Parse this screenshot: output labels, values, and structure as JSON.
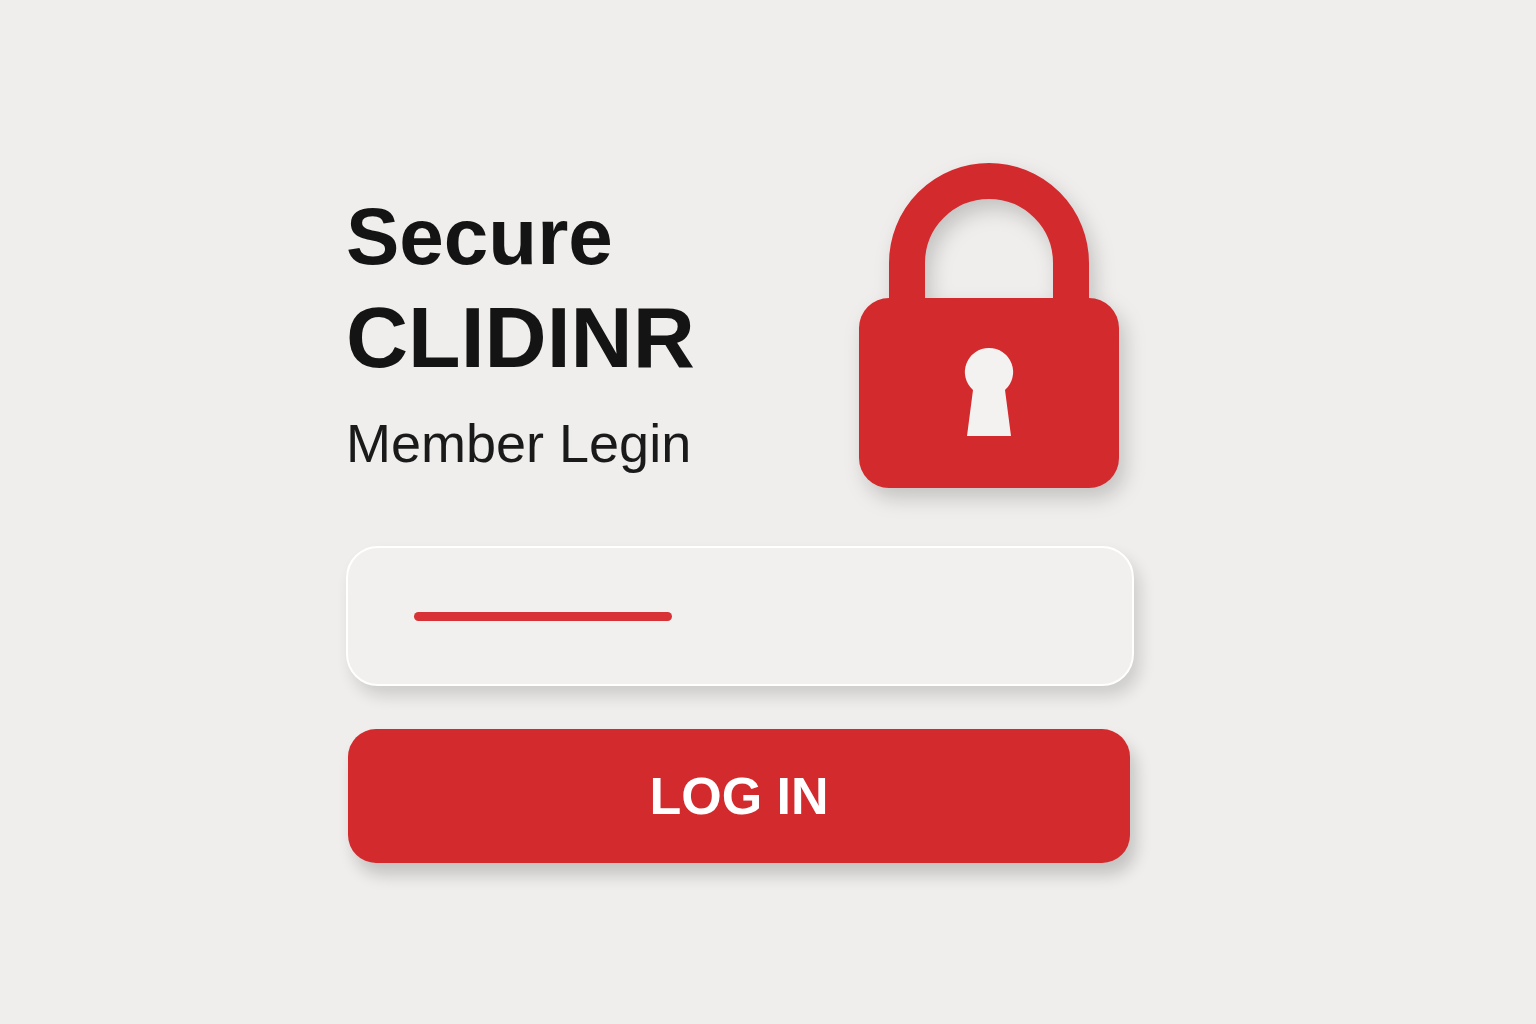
{
  "heading": [
    "Secure",
    "CLIDINR"
  ],
  "subtitle": "Member Legin",
  "login_button": {
    "label": "LOG IN"
  }
}
